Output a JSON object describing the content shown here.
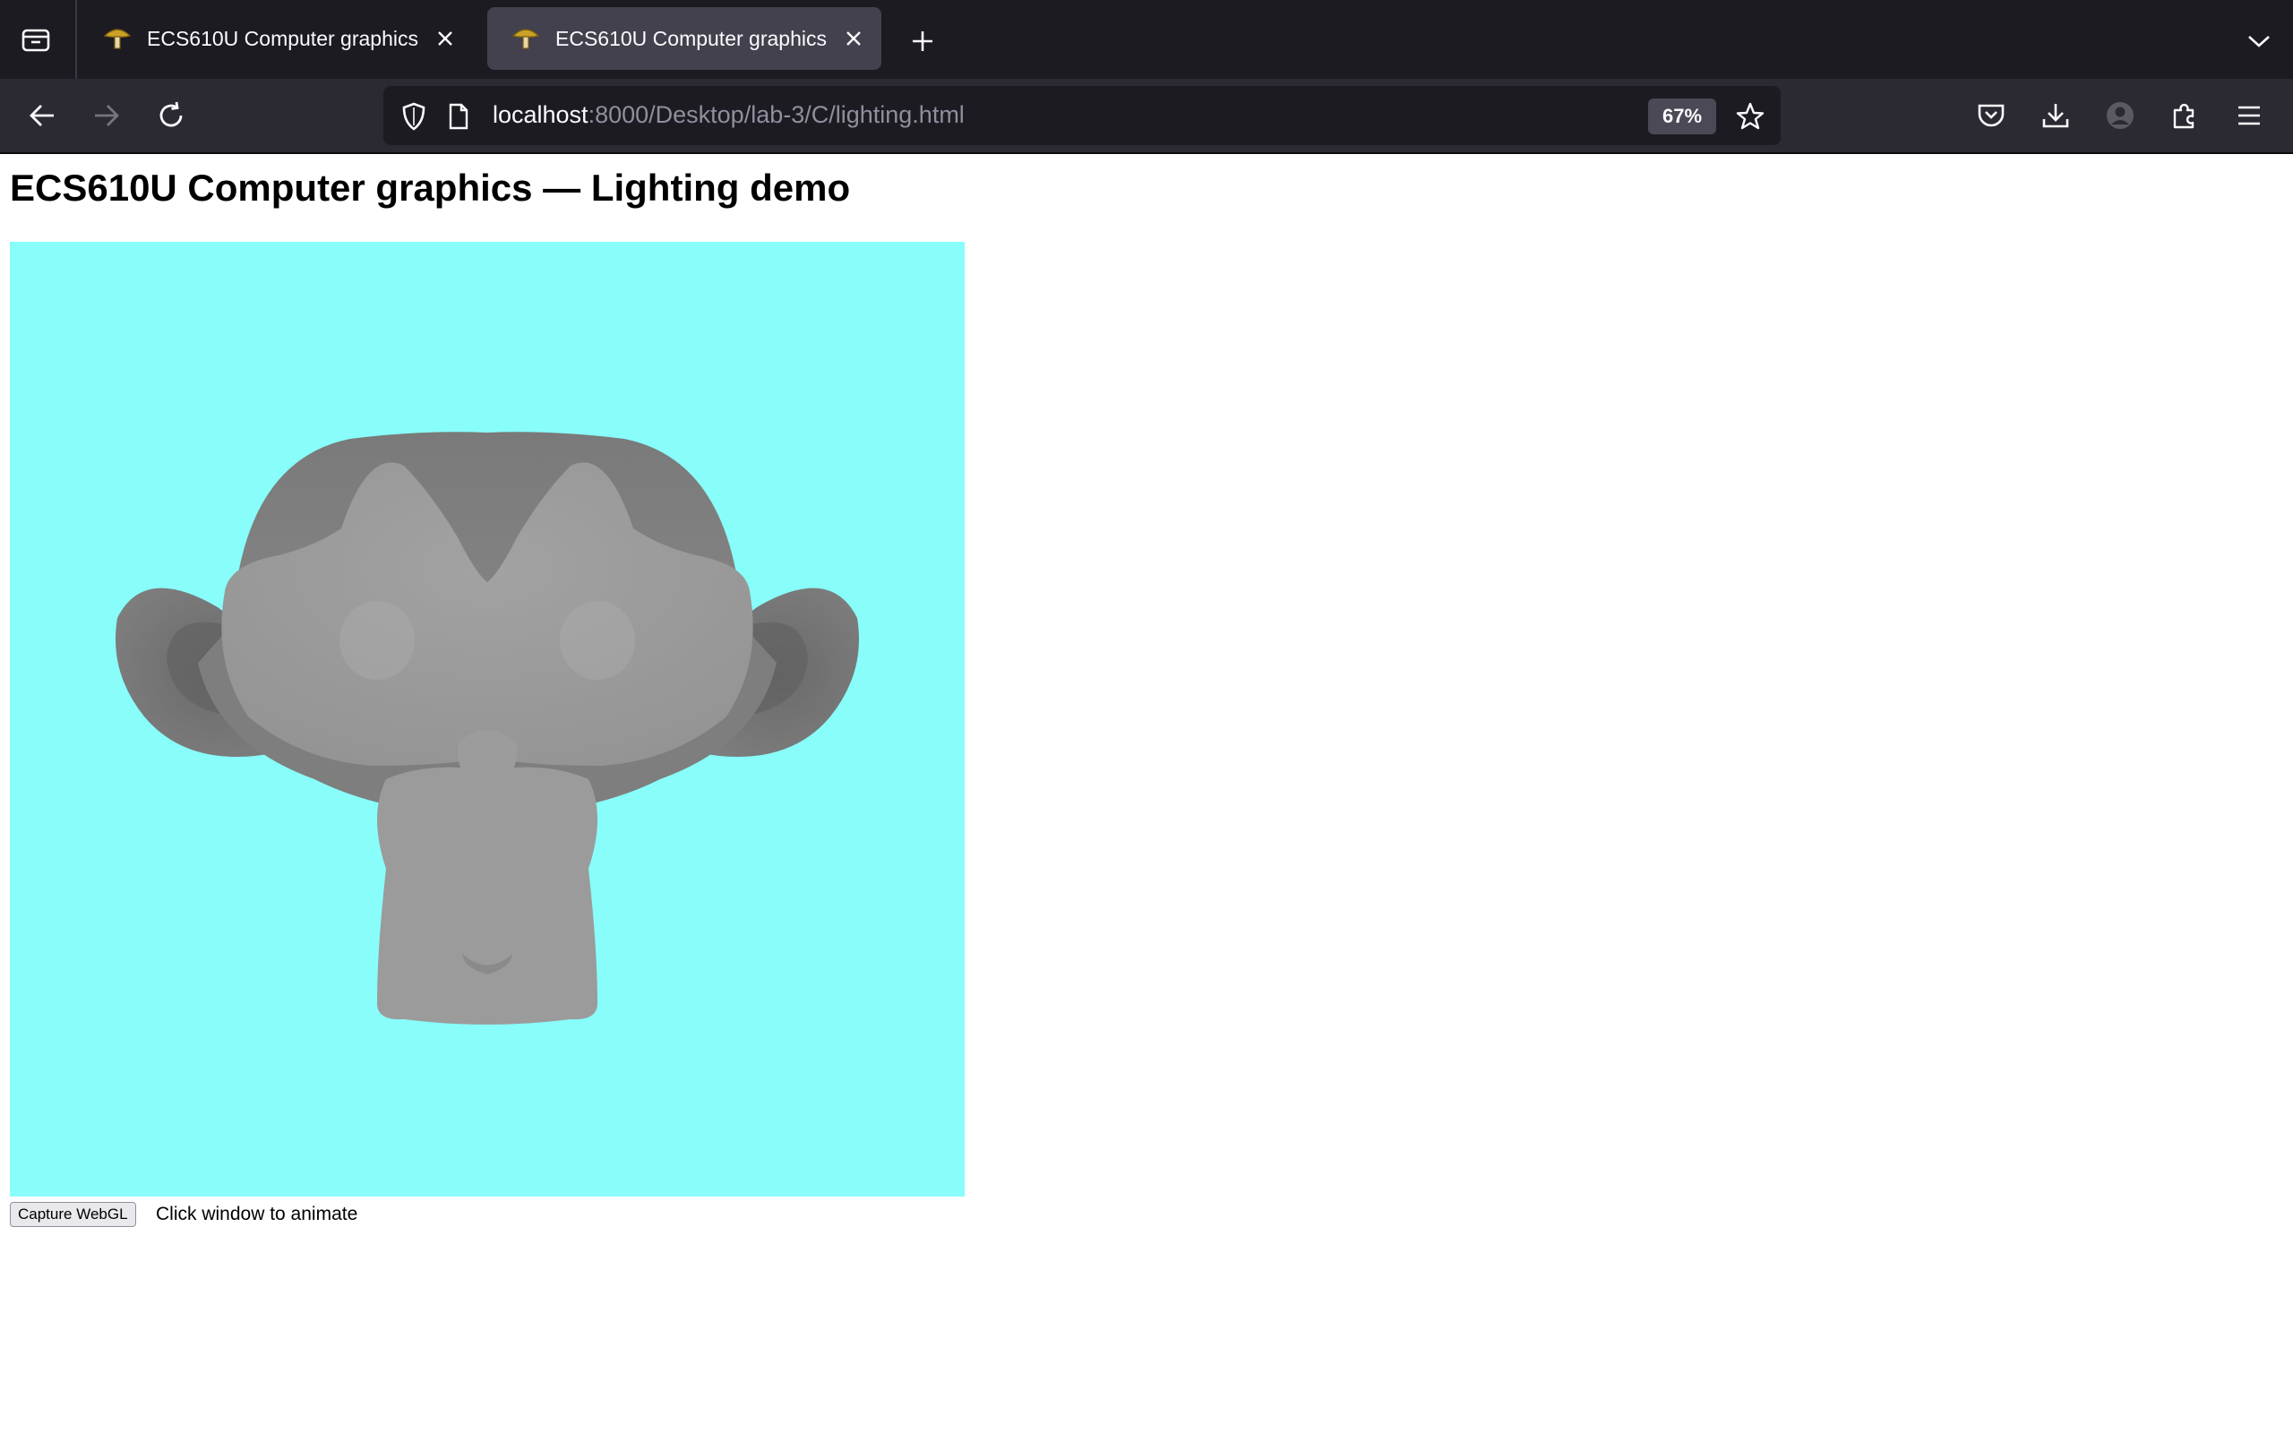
{
  "browser": {
    "tabs": [
      {
        "title": "ECS610U Computer graphics",
        "active": false
      },
      {
        "title": "ECS610U Computer graphics",
        "active": true
      }
    ],
    "url": {
      "host": "localhost",
      "rest": ":8000/Desktop/lab-3/C/lighting.html"
    },
    "zoom": "67%",
    "icons": {
      "tab_overview": "tab-list-icon",
      "favicon": "mushroom-icon",
      "close": "close-icon",
      "new_tab": "plus-icon",
      "list_all_tabs": "chevron-down-icon",
      "back": "back-arrow-icon",
      "forward": "forward-arrow-icon",
      "reload": "reload-icon",
      "tracking": "shield-icon",
      "page": "page-icon",
      "bookmark": "star-icon",
      "pocket": "pocket-icon",
      "downloads": "download-icon",
      "account": "account-icon",
      "extensions": "puzzle-icon",
      "menu": "hamburger-menu-icon"
    }
  },
  "page": {
    "heading": "ECS610U Computer graphics — Lighting demo",
    "canvas_background": "#88fdfa",
    "capture_button": "Capture WebGL",
    "hint": "Click window to animate"
  }
}
